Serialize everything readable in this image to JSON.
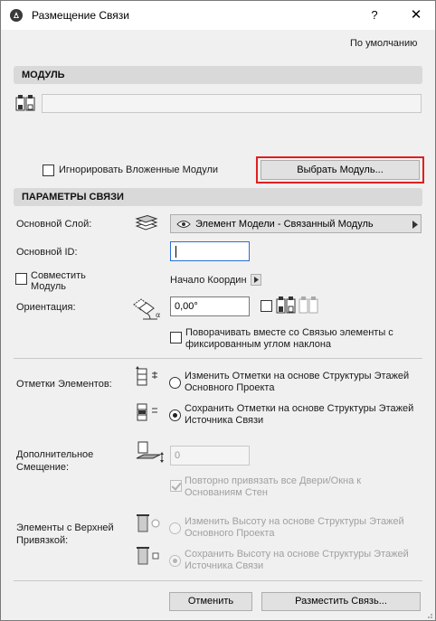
{
  "window": {
    "title": "Размещение Связи",
    "help": "?",
    "close": "✕"
  },
  "defaults_link": "По умолчанию",
  "module": {
    "header": "МОДУЛЬ",
    "ignore_nested_label": "Игнорировать Вложенные Модули",
    "choose_button": "Выбрать Модуль..."
  },
  "link_params": {
    "header": "ПАРАМЕТРЫ СВЯЗИ",
    "main_layer_label": "Основной Слой:",
    "main_layer_value": "Элемент Модели - Связанный Модуль",
    "main_id_label": "Основной ID:",
    "main_id_value": "",
    "align_label_1": "Совместить",
    "align_label_2": "Модуль",
    "origin_label": "Начало Координ",
    "orientation_label": "Ориентация:",
    "orientation_value": "0,00°",
    "rotate_label_1": "Поворачивать вместе со Связью элементы с",
    "rotate_label_2": "фиксированным углом наклона"
  },
  "element_elevations": {
    "label": "Отметки Элементов:",
    "option1_1": "Изменить Отметки на основе Структуры Этажей",
    "option1_2": "Основного Проекта",
    "option2_1": "Сохранить Отметки на основе Структуры Этажей",
    "option2_2": "Источника Связи",
    "selected": 2
  },
  "additional_offset": {
    "label_1": "Дополнительное",
    "label_2": "Смещение:",
    "value": "0",
    "rebind_1": "Повторно привязать все Двери/Окна к",
    "rebind_2": "Основаниям Стен"
  },
  "top_linked": {
    "label_1": "Элементы с Верхней",
    "label_2": "Привязкой:",
    "option1_1": "Изменить Высоту на основе Структуры Этажей",
    "option1_2": "Основного Проекта",
    "option2_1": "Сохранить Высоту на основе Структуры Этажей",
    "option2_2": "Источника Связи",
    "selected": 2
  },
  "footer": {
    "cancel": "Отменить",
    "place": "Разместить Связь..."
  },
  "colors": {
    "highlight": "#e02020",
    "header_bg": "#d9d9d9",
    "dialog_bg": "#f0f0f0"
  },
  "icons": [
    "archicad-logo-icon",
    "module-file-icon",
    "layer-stack-icon",
    "eye-icon",
    "orientation-angle-icon",
    "mirror-icon",
    "elevation-story-icon",
    "offset-icon",
    "top-link-icon",
    "triangle-right-icon"
  ]
}
